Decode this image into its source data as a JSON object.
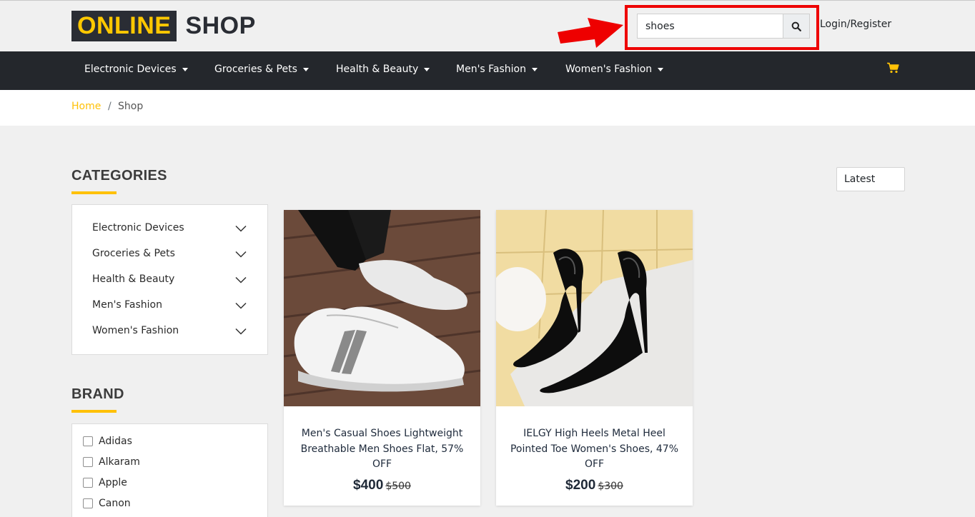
{
  "header": {
    "logo_highlight": "ONLINE",
    "logo_rest": "SHOP",
    "search": {
      "value": "shoes",
      "placeholder": ""
    },
    "login_label": "Login/Register"
  },
  "nav": {
    "items": [
      {
        "label": "Electronic Devices"
      },
      {
        "label": "Groceries & Pets"
      },
      {
        "label": "Health & Beauty"
      },
      {
        "label": "Men's Fashion"
      },
      {
        "label": "Women's Fashion"
      }
    ],
    "cart_icon": "cart-icon"
  },
  "breadcrumb": {
    "home": "Home",
    "separator": "/",
    "current": "Shop"
  },
  "sidebar": {
    "categories_title": "CATEGORIES",
    "categories": [
      {
        "label": "Electronic Devices"
      },
      {
        "label": "Groceries & Pets"
      },
      {
        "label": "Health & Beauty"
      },
      {
        "label": "Men's Fashion"
      },
      {
        "label": "Women's Fashion"
      }
    ],
    "brand_title": "BRAND",
    "brands": [
      {
        "label": "Adidas"
      },
      {
        "label": "Alkaram"
      },
      {
        "label": "Apple"
      },
      {
        "label": "Canon"
      }
    ]
  },
  "sort": {
    "selected": "Latest"
  },
  "products": [
    {
      "title": "Men's Casual Shoes Lightweight Breathable Men Shoes Flat, 57% OFF",
      "price": "$400",
      "old_price": "$500"
    },
    {
      "title": "IELGY High Heels Metal Heel Pointed Toe Women's Shoes, 47% OFF",
      "price": "$200",
      "old_price": "$300"
    }
  ],
  "colors": {
    "accent": "#ffc107",
    "nav_bg": "#24272c",
    "highlight": "#ee0000"
  }
}
